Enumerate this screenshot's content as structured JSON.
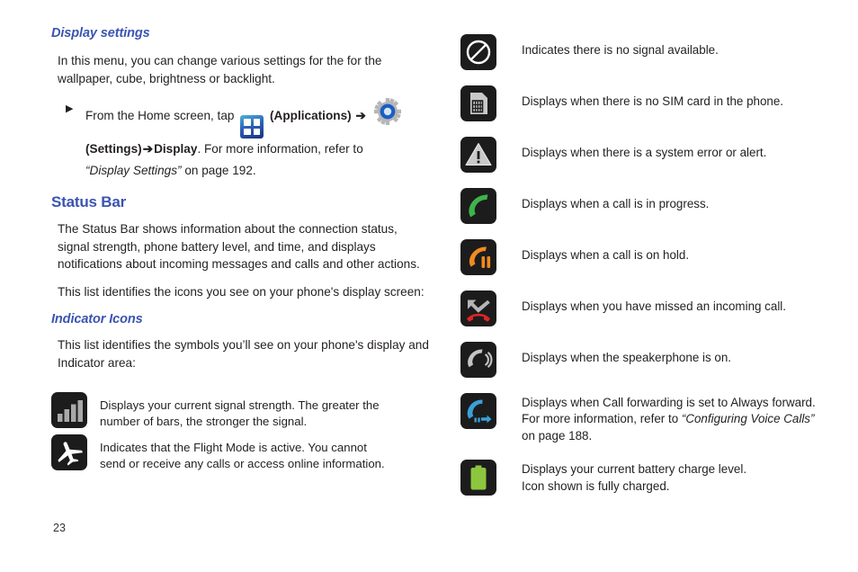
{
  "page": {
    "number": "23"
  },
  "left": {
    "display_settings": {
      "heading": "Display settings",
      "intro": "In this menu, you can change various settings for the for the wallpaper, cube, brightness or backlight.",
      "bullet": {
        "line1_pre": "From the Home screen, tap",
        "applications_label": "(Applications)",
        "arrow1": "➔",
        "settings_label": "(Settings)",
        "arrow2": "➔",
        "display_label": "Display",
        "line2_post": ". For more information, refer to",
        "reference": "“Display Settings”",
        "page_ref": "on page 192.",
        "bullet_glyph": "▶",
        "applications_icon": "applications-grid-icon",
        "settings_icon": "settings-gear-icon"
      }
    },
    "status_bar": {
      "heading": "Status Bar",
      "paragraph1": "The Status Bar shows information about the connection status, signal strength, phone battery level, and time, and displays notifications about incoming messages and calls and other actions.",
      "paragraph2": "This list identifies the icons you see on your phone's display screen:"
    },
    "indicator_icons": {
      "heading": "Indicator Icons",
      "paragraph": "This list identifies the symbols you’ll see on your phone's display and Indicator area:"
    },
    "icon_rows": [
      {
        "icon": "signal-strength-icon",
        "lines": [
          "Displays your current signal strength. The greater the",
          "number of bars, the stronger the signal."
        ]
      },
      {
        "icon": "flight-mode-airplane-icon",
        "lines": [
          "Indicates that the Flight Mode is active. You cannot",
          "send or receive any calls or access online information."
        ]
      }
    ]
  },
  "right": {
    "icon_rows": [
      {
        "icon": "no-signal-icon",
        "lines": [
          "Indicates there is no signal available."
        ]
      },
      {
        "icon": "no-sim-card-icon",
        "lines": [
          "Displays when there is no SIM card in the phone."
        ]
      },
      {
        "icon": "system-alert-warning-icon",
        "lines": [
          "Displays when there is a system error or alert."
        ]
      },
      {
        "icon": "call-in-progress-icon",
        "lines": [
          "Displays when a call is in progress."
        ]
      },
      {
        "icon": "call-on-hold-icon",
        "lines": [
          "Displays when a call is on hold."
        ]
      },
      {
        "icon": "missed-call-icon",
        "lines": [
          "Displays when you have missed an incoming call."
        ]
      },
      {
        "icon": "speakerphone-icon",
        "lines": [
          "Displays when the speakerphone is on."
        ]
      },
      {
        "icon": "call-forwarding-icon",
        "lines": [
          "Displays when Call forwarding is set to Always forward.",
          "For more information, refer to ",
          "on page 188."
        ],
        "reference": "“Configuring Voice Calls”"
      },
      {
        "icon": "battery-full-icon",
        "lines": [
          "Displays your current battery charge level.",
          "Icon shown is fully charged."
        ]
      }
    ]
  },
  "colors": {
    "heading_blue": "#3b54b0",
    "body_text": "#231f20",
    "tile_dark": "#1c1c1c",
    "green_call": "#3fb34b",
    "orange_hold": "#f08a1e",
    "red_missed": "#e02427",
    "blue_forward": "#3aa0d8",
    "green_battery": "#8cc63f",
    "gray_icon": "#bcbcbc"
  }
}
